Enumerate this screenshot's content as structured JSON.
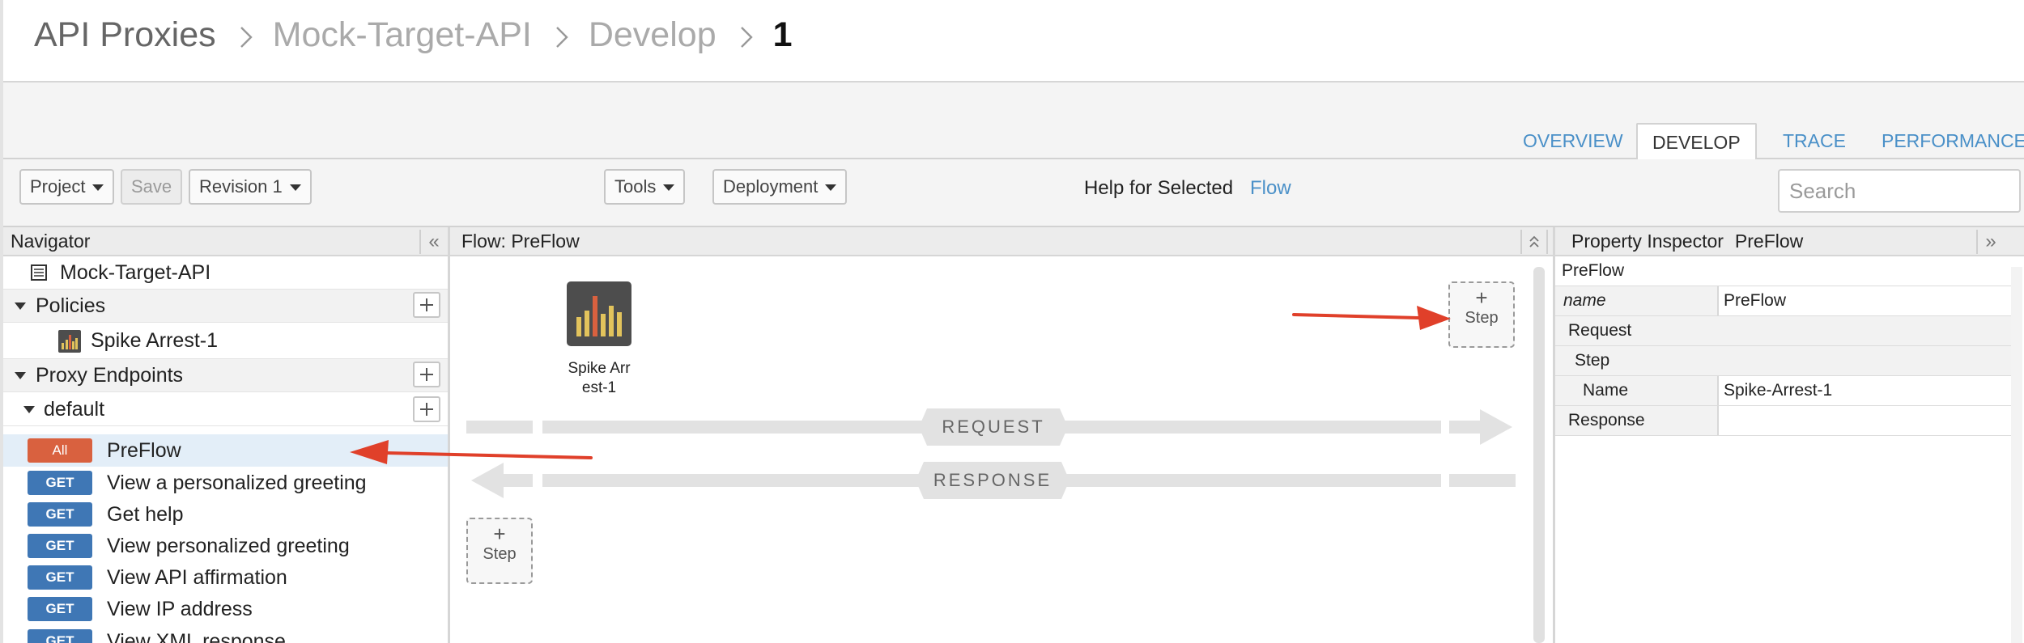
{
  "breadcrumb": {
    "items": [
      "API Proxies",
      "Mock-Target-API",
      "Develop"
    ],
    "current": "1"
  },
  "tabs": [
    "OVERVIEW",
    "DEVELOP",
    "TRACE",
    "PERFORMANCE"
  ],
  "active_tab": "DEVELOP",
  "toolbar": {
    "project_label": "Project",
    "save_label": "Save",
    "revision_label": "Revision 1",
    "tools_label": "Tools",
    "deployment_label": "Deployment",
    "help_label": "Help for Selected",
    "help_link": "Flow",
    "search_placeholder": "Search"
  },
  "navigator": {
    "title": "Navigator",
    "collapse_glyph": "«",
    "proxy_name": "Mock-Target-API",
    "policies_label": "Policies",
    "policies": [
      "Spike Arrest-1"
    ],
    "proxy_endpoints_label": "Proxy Endpoints",
    "endpoint_name": "default",
    "flows": [
      {
        "verb": "All",
        "label": "PreFlow"
      },
      {
        "verb": "GET",
        "label": "View a personalized greeting"
      },
      {
        "verb": "GET",
        "label": "Get help"
      },
      {
        "verb": "GET",
        "label": "View personalized greeting"
      },
      {
        "verb": "GET",
        "label": "View API affirmation"
      },
      {
        "verb": "GET",
        "label": "View IP address"
      },
      {
        "verb": "GET",
        "label": "View XML response"
      }
    ]
  },
  "flow": {
    "title": "Flow: PreFlow",
    "policy_label_line1": "Spike Arr",
    "policy_label_line2": "est-1",
    "request_label": "REQUEST",
    "response_label": "RESPONSE",
    "step_plus": "+",
    "step_label": "Step"
  },
  "inspector": {
    "title": "Property Inspector",
    "subject": "PreFlow",
    "expand_glyph": "»",
    "rows": {
      "header": "PreFlow",
      "name_key": "name",
      "name_value": "PreFlow",
      "request": "Request",
      "step": "Step",
      "step_name_key": "Name",
      "step_name_value": "Spike-Arrest-1",
      "response": "Response"
    }
  },
  "colors": {
    "accent_link": "#4a90c8",
    "verb_get": "#3f77b5",
    "verb_all": "#d9613f",
    "annotation_arrow": "#e0402a",
    "selected_row": "#e3eef8"
  },
  "icons": {
    "policy": "bar-chart-icon",
    "proxy": "document-list-icon",
    "breadcrumb_separator": "chevron-right-icon"
  }
}
